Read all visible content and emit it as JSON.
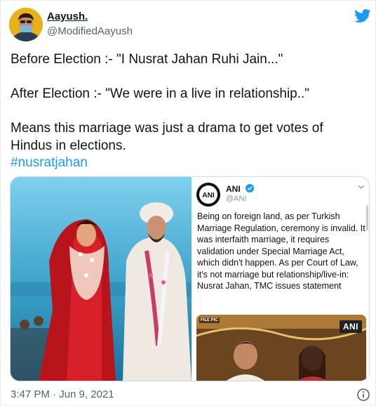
{
  "user": {
    "display_name": "Aayush.",
    "handle": "@ModifiedAayush",
    "avatar_icon": "avatar-photo-icon"
  },
  "platform_icon": "twitter-bird-icon",
  "colors": {
    "brand_blue": "#1d9bf0",
    "hashtag": "#1d9bf0",
    "secondary_text": "#536471",
    "border": "#cfd9de"
  },
  "tweet": {
    "line1": "Before Election :- \"I Nusrat Jahan Ruhi Jain...\"",
    "line2": "After Election :- \"We were in a live in relationship..\"",
    "line3": "Means this marriage was just a drama to get votes of Hindus in elections.",
    "hashtag": "#nusratjahan"
  },
  "embedded_screenshot": {
    "account_name": "ANI",
    "account_handle": "@ANI",
    "logo_text": "ANI",
    "body": "Being on foreign land, as per Turkish Marriage Regulation, ceremony is invalid. It was interfaith marriage, it requires validation under Special Marriage Act, which didn't happen. As per Court of Law, it's not marriage but relationship/live-in: Nusrat Jahan, TMC issues statement",
    "thumb_tag": "FILE PIC",
    "thumb_badge": "ANI"
  },
  "footer": {
    "timestamp": "3:47 PM · Jun 9, 2021",
    "info_icon": "info-icon"
  }
}
